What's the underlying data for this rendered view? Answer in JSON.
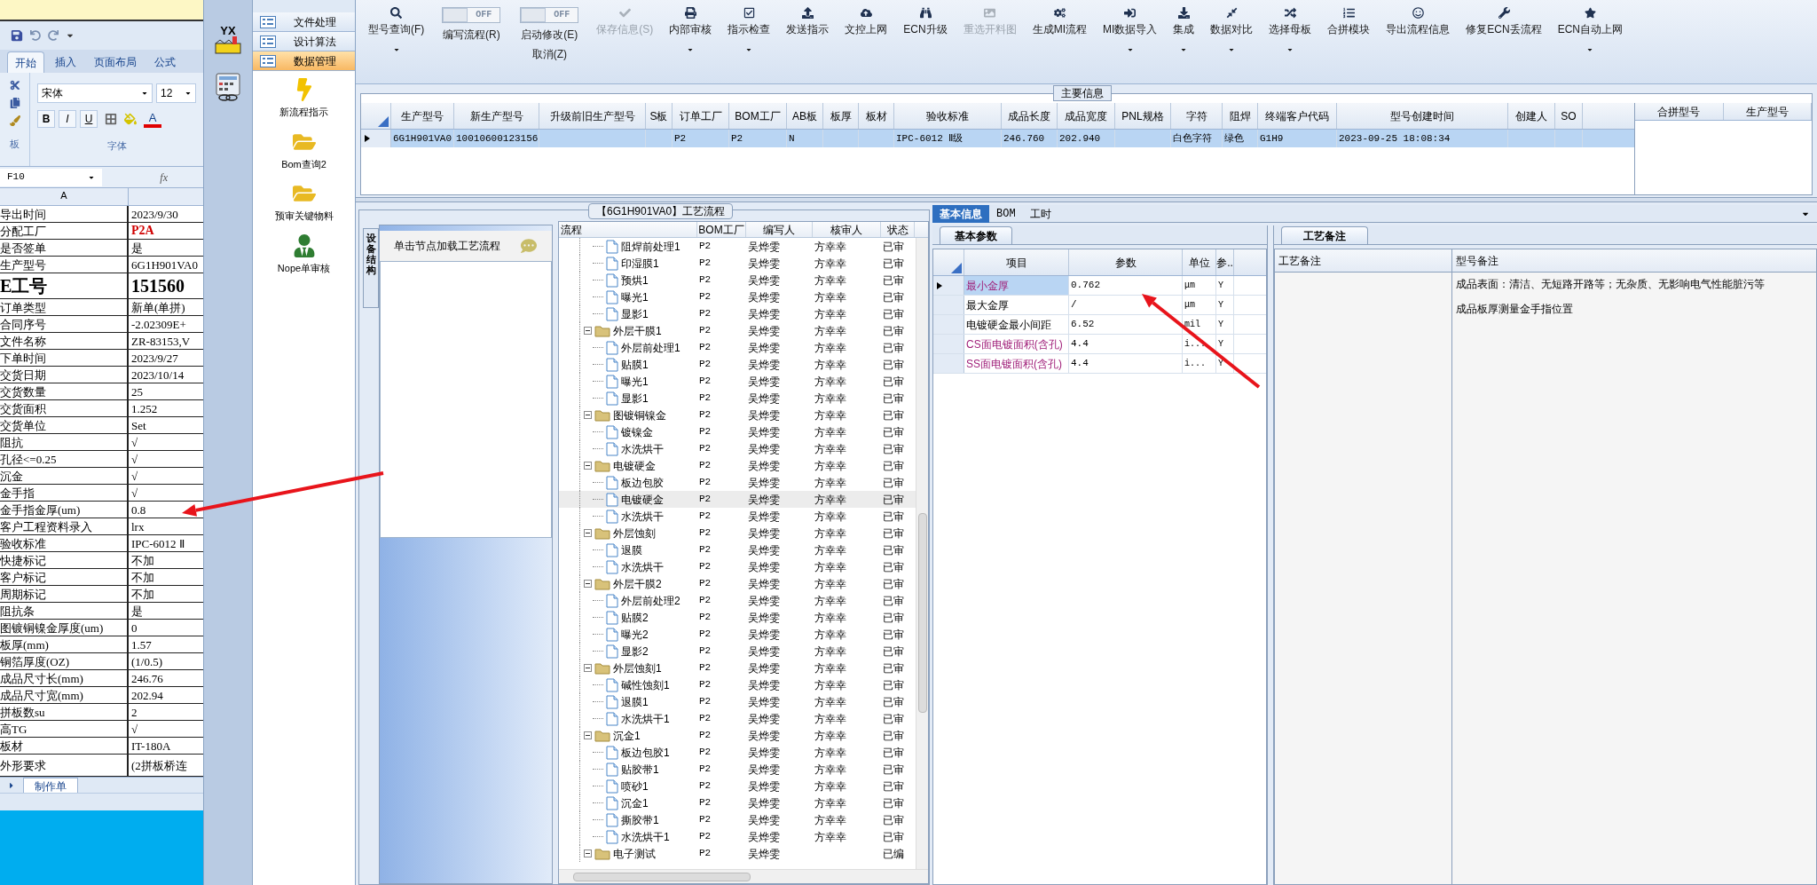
{
  "excel": {
    "tabs": [
      {
        "label": "开始",
        "selected": true
      },
      {
        "label": "插入",
        "selected": false
      },
      {
        "label": "页面布局",
        "selected": false
      },
      {
        "label": "公式",
        "selected": false
      }
    ],
    "font": "宋体",
    "size": "12",
    "format_buttons": [
      "B",
      "I",
      "U"
    ],
    "font_color_button": "A",
    "clipboard_label": "板",
    "font_group_label": "字体",
    "name_box": "F10",
    "fx": "fx",
    "column_header": "A",
    "sheet_tab": "制作单",
    "rows": [
      {
        "label": "导出时间",
        "value": "2023/9/30",
        "kind": "normal"
      },
      {
        "label": "分配工厂",
        "value": "P2A",
        "kind": "alert"
      },
      {
        "label": "是否签单",
        "value": "是",
        "kind": "normal"
      },
      {
        "label": "生产型号",
        "value": "6G1H901VA0",
        "kind": "normal"
      },
      {
        "label": "E工号",
        "value": "151560",
        "kind": "large"
      },
      {
        "label": "订单类型",
        "value": "新单(单拼)",
        "kind": "normal"
      },
      {
        "label": "合同序号",
        "value": "-2.02309E+",
        "kind": "normal"
      },
      {
        "label": "文件名称",
        "value": "ZR-83153,V",
        "kind": "normal"
      },
      {
        "label": "下单时间",
        "value": "2023/9/27",
        "kind": "normal"
      },
      {
        "label": "交货日期",
        "value": "2023/10/14",
        "kind": "normal"
      },
      {
        "label": "交货数量",
        "value": "25",
        "kind": "normal"
      },
      {
        "label": "交货面积",
        "value": "1.252",
        "kind": "normal"
      },
      {
        "label": "交货单位",
        "value": "Set",
        "kind": "normal"
      },
      {
        "label": "阻抗",
        "value": "√",
        "kind": "normal"
      },
      {
        "label": "孔径<=0.25",
        "value": "√",
        "kind": "normal"
      },
      {
        "label": "沉金",
        "value": "√",
        "kind": "normal"
      },
      {
        "label": "金手指",
        "value": "√",
        "kind": "normal"
      },
      {
        "label": "金手指金厚(um)",
        "value": "0.8",
        "kind": "normal"
      },
      {
        "label": "客户工程资料录入",
        "value": "lrx",
        "kind": "normal"
      },
      {
        "label": "验收标准",
        "value": "IPC-6012 Ⅱ",
        "kind": "normal"
      },
      {
        "label": "快捷标记",
        "value": "不加",
        "kind": "normal"
      },
      {
        "label": "客户标记",
        "value": "不加",
        "kind": "normal"
      },
      {
        "label": "周期标记",
        "value": "不加",
        "kind": "normal"
      },
      {
        "label": "阻抗条",
        "value": "是",
        "kind": "normal"
      },
      {
        "label": "图镀铜镍金厚度(um)",
        "value": "0",
        "kind": "normal"
      },
      {
        "label": "板厚(mm)",
        "value": "1.57",
        "kind": "normal"
      },
      {
        "label": "铜箔厚度(OZ)",
        "value": "(1/0.5)",
        "kind": "normal"
      },
      {
        "label": "成品尺寸长(mm)",
        "value": "246.76",
        "kind": "normal"
      },
      {
        "label": "成品尺寸宽(mm)",
        "value": "202.94",
        "kind": "normal"
      },
      {
        "label": "拼板数su",
        "value": "2",
        "kind": "normal"
      },
      {
        "label": "高TG",
        "value": "√",
        "kind": "normal"
      },
      {
        "label": "板材",
        "value": "IT-180A",
        "kind": "normal"
      },
      {
        "label": "外形要求",
        "value": "(2拼板桥连",
        "kind": "tall"
      }
    ]
  },
  "app": {
    "logo_text": "YX",
    "nav": [
      {
        "label": "文件处理",
        "selected": false
      },
      {
        "label": "设计算法",
        "selected": false
      },
      {
        "label": "数据管理",
        "selected": true
      }
    ],
    "shortcuts": [
      "新流程指示",
      "Bom查询2",
      "预审关键物料",
      "Nope单审核"
    ]
  },
  "toolbar": [
    {
      "kind": "button",
      "label": "型号查询(F)",
      "dropdown": true,
      "disabled": false
    },
    {
      "kind": "toggle",
      "switch_text": "OFF",
      "on": false,
      "label": "编写流程(R)"
    },
    {
      "kind": "toggle",
      "switch_text": "OFF",
      "on": false,
      "label": "启动修改(E)",
      "sublabel": "取消(Z)"
    },
    {
      "kind": "button",
      "label": "保存信息(S)",
      "dropdown": false,
      "disabled": true
    },
    {
      "kind": "button",
      "label": "内部审核",
      "dropdown": true,
      "disabled": false
    },
    {
      "kind": "button",
      "label": "指示检查",
      "dropdown": true,
      "disabled": false
    },
    {
      "kind": "button",
      "label": "发送指示",
      "dropdown": false,
      "disabled": false
    },
    {
      "kind": "button",
      "label": "文控上网",
      "dropdown": false,
      "disabled": false
    },
    {
      "kind": "button",
      "label": "ECN升级",
      "dropdown": false,
      "disabled": false
    },
    {
      "kind": "button",
      "label": "重选开料图",
      "dropdown": false,
      "disabled": true
    },
    {
      "kind": "button",
      "label": "生成MI流程",
      "dropdown": false,
      "disabled": false
    },
    {
      "kind": "button",
      "label": "MI数据导入",
      "dropdown": true,
      "disabled": false
    },
    {
      "kind": "button",
      "label": "集成",
      "dropdown": true,
      "disabled": false
    },
    {
      "kind": "button",
      "label": "数据对比",
      "dropdown": true,
      "disabled": false
    },
    {
      "kind": "button",
      "label": "选择母板",
      "dropdown": true,
      "disabled": false
    },
    {
      "kind": "button",
      "label": "合拼模块",
      "dropdown": false,
      "disabled": false
    },
    {
      "kind": "button",
      "label": "导出流程信息",
      "dropdown": false,
      "disabled": false
    },
    {
      "kind": "button",
      "label": "修复ECN丢流程",
      "dropdown": false,
      "disabled": false
    },
    {
      "kind": "button",
      "label": "ECN自动上网",
      "dropdown": true,
      "disabled": false
    }
  ],
  "main_info": {
    "title": "主要信息",
    "columns": [
      "生产型号",
      "新生产型号",
      "升级前旧生产型号",
      "S板",
      "订单工厂",
      "BOM工厂",
      "AB板",
      "板厚",
      "板材",
      "验收标准",
      "成品长度",
      "成品宽度",
      "PNL规格",
      "字符",
      "阻焊",
      "终端客户代码",
      "型号创建时间",
      "创建人",
      "SO"
    ],
    "rows": [
      {
        "selected": true,
        "cells": [
          "6G1H901VA0",
          "10010600123156",
          null,
          null,
          "P2",
          "P2",
          "N",
          null,
          null,
          "IPC-6012 Ⅱ级",
          "246.760",
          "202.940",
          null,
          "白色字符",
          "绿色",
          "G1H9",
          "2023-09-25 18:08:34",
          null,
          null
        ]
      }
    ],
    "merge_columns": [
      "合拼型号",
      "生产型号"
    ]
  },
  "process": {
    "title": "【6G1H901VA0】工艺流程",
    "side_tab": "设备结构",
    "hint": "单击节点加载工艺流程",
    "columns": [
      "流程",
      "BOM工厂",
      "编写人",
      "核审人",
      "状态"
    ],
    "nodes": [
      {
        "kind": "continued",
        "children": [
          {
            "label": "阻焊前处理1",
            "bom": "P2",
            "writer": "吴烨雯",
            "reviewer": "方幸幸",
            "status": "已审",
            "selected": false
          },
          {
            "label": "印湿膜1",
            "bom": "P2",
            "writer": "吴烨雯",
            "reviewer": "方幸幸",
            "status": "已审",
            "selected": false
          },
          {
            "label": "预烘1",
            "bom": "P2",
            "writer": "吴烨雯",
            "reviewer": "方幸幸",
            "status": "已审",
            "selected": false
          },
          {
            "label": "曝光1",
            "bom": "P2",
            "writer": "吴烨雯",
            "reviewer": "方幸幸",
            "status": "已审",
            "selected": false
          },
          {
            "label": "显影1",
            "bom": "P2",
            "writer": "吴烨雯",
            "reviewer": "方幸幸",
            "status": "已审",
            "selected": false
          }
        ]
      },
      {
        "kind": "group",
        "label": "外层干膜1",
        "bom": "P2",
        "writer": "吴烨雯",
        "reviewer": "方幸幸",
        "status": "已审",
        "selected": false,
        "expanded": true,
        "children": [
          {
            "label": "外层前处理1",
            "bom": "P2",
            "writer": "吴烨雯",
            "reviewer": "方幸幸",
            "status": "已审",
            "selected": false
          },
          {
            "label": "贴膜1",
            "bom": "P2",
            "writer": "吴烨雯",
            "reviewer": "方幸幸",
            "status": "已审",
            "selected": false
          },
          {
            "label": "曝光1",
            "bom": "P2",
            "writer": "吴烨雯",
            "reviewer": "方幸幸",
            "status": "已审",
            "selected": false
          },
          {
            "label": "显影1",
            "bom": "P2",
            "writer": "吴烨雯",
            "reviewer": "方幸幸",
            "status": "已审",
            "selected": false
          }
        ]
      },
      {
        "kind": "group",
        "label": "图镀铜镍金",
        "bom": "P2",
        "writer": "吴烨雯",
        "reviewer": "方幸幸",
        "status": "已审",
        "selected": false,
        "expanded": true,
        "children": [
          {
            "label": "镀镍金",
            "bom": "P2",
            "writer": "吴烨雯",
            "reviewer": "方幸幸",
            "status": "已审",
            "selected": false
          },
          {
            "label": "水洗烘干",
            "bom": "P2",
            "writer": "吴烨雯",
            "reviewer": "方幸幸",
            "status": "已审",
            "selected": false
          }
        ]
      },
      {
        "kind": "group",
        "label": "电镀硬金",
        "bom": "P2",
        "writer": "吴烨雯",
        "reviewer": "方幸幸",
        "status": "已审",
        "selected": false,
        "expanded": true,
        "children": [
          {
            "label": "板边包胶",
            "bom": "P2",
            "writer": "吴烨雯",
            "reviewer": "方幸幸",
            "status": "已审",
            "selected": false
          },
          {
            "label": "电镀硬金",
            "bom": "P2",
            "writer": "吴烨雯",
            "reviewer": "方幸幸",
            "status": "已审",
            "selected": true
          },
          {
            "label": "水洗烘干",
            "bom": "P2",
            "writer": "吴烨雯",
            "reviewer": "方幸幸",
            "status": "已审",
            "selected": false
          }
        ]
      },
      {
        "kind": "group",
        "label": "外层蚀刻",
        "bom": "P2",
        "writer": "吴烨雯",
        "reviewer": "方幸幸",
        "status": "已审",
        "selected": false,
        "expanded": true,
        "children": [
          {
            "label": "退膜",
            "bom": "P2",
            "writer": "吴烨雯",
            "reviewer": "方幸幸",
            "status": "已审",
            "selected": false
          },
          {
            "label": "水洗烘干",
            "bom": "P2",
            "writer": "吴烨雯",
            "reviewer": "方幸幸",
            "status": "已审",
            "selected": false
          }
        ]
      },
      {
        "kind": "group",
        "label": "外层干膜2",
        "bom": "P2",
        "writer": "吴烨雯",
        "reviewer": "方幸幸",
        "status": "已审",
        "selected": false,
        "expanded": true,
        "children": [
          {
            "label": "外层前处理2",
            "bom": "P2",
            "writer": "吴烨雯",
            "reviewer": "方幸幸",
            "status": "已审",
            "selected": false
          },
          {
            "label": "贴膜2",
            "bom": "P2",
            "writer": "吴烨雯",
            "reviewer": "方幸幸",
            "status": "已审",
            "selected": false
          },
          {
            "label": "曝光2",
            "bom": "P2",
            "writer": "吴烨雯",
            "reviewer": "方幸幸",
            "status": "已审",
            "selected": false
          },
          {
            "label": "显影2",
            "bom": "P2",
            "writer": "吴烨雯",
            "reviewer": "方幸幸",
            "status": "已审",
            "selected": false
          }
        ]
      },
      {
        "kind": "group",
        "label": "外层蚀刻1",
        "bom": "P2",
        "writer": "吴烨雯",
        "reviewer": "方幸幸",
        "status": "已审",
        "selected": false,
        "expanded": true,
        "children": [
          {
            "label": "碱性蚀刻1",
            "bom": "P2",
            "writer": "吴烨雯",
            "reviewer": "方幸幸",
            "status": "已审",
            "selected": false
          },
          {
            "label": "退膜1",
            "bom": "P2",
            "writer": "吴烨雯",
            "reviewer": "方幸幸",
            "status": "已审",
            "selected": false
          },
          {
            "label": "水洗烘干1",
            "bom": "P2",
            "writer": "吴烨雯",
            "reviewer": "方幸幸",
            "status": "已审",
            "selected": false
          }
        ]
      },
      {
        "kind": "group",
        "label": "沉金1",
        "bom": "P2",
        "writer": "吴烨雯",
        "reviewer": "方幸幸",
        "status": "已审",
        "selected": false,
        "expanded": true,
        "children": [
          {
            "label": "板边包胶1",
            "bom": "P2",
            "writer": "吴烨雯",
            "reviewer": "方幸幸",
            "status": "已审",
            "selected": false
          },
          {
            "label": "贴胶带1",
            "bom": "P2",
            "writer": "吴烨雯",
            "reviewer": "方幸幸",
            "status": "已审",
            "selected": false
          },
          {
            "label": "喷砂1",
            "bom": "P2",
            "writer": "吴烨雯",
            "reviewer": "方幸幸",
            "status": "已审",
            "selected": false
          },
          {
            "label": "沉金1",
            "bom": "P2",
            "writer": "吴烨雯",
            "reviewer": "方幸幸",
            "status": "已审",
            "selected": false
          },
          {
            "label": "撕胶带1",
            "bom": "P2",
            "writer": "吴烨雯",
            "reviewer": "方幸幸",
            "status": "已审",
            "selected": false
          },
          {
            "label": "水洗烘干1",
            "bom": "P2",
            "writer": "吴烨雯",
            "reviewer": "方幸幸",
            "status": "已审",
            "selected": false
          }
        ]
      },
      {
        "kind": "group",
        "label": "电子测试",
        "bom": "P2",
        "writer": "吴烨雯",
        "status": "已编",
        "selected": false,
        "expanded": true
      }
    ]
  },
  "details": {
    "tabs": [
      {
        "label": "基本信息",
        "selected": true
      },
      {
        "label": "BOM",
        "selected": false
      },
      {
        "label": "工时",
        "selected": false
      }
    ],
    "params": {
      "tab": "基本参数",
      "columns": [
        "项目",
        "参数",
        "单位",
        "参.."
      ],
      "rows": [
        {
          "name": "最小金厚",
          "value": "0.762",
          "unit": "μm",
          "flag": "Y",
          "kind": "highlight",
          "selected": true
        },
        {
          "name": "最大金厚",
          "value": "/",
          "unit": "μm",
          "flag": "Y",
          "kind": "normal",
          "selected": false
        },
        {
          "name": "电镀硬金最小间距",
          "value": "6.52",
          "unit": "mil",
          "flag": "Y",
          "kind": "normal",
          "selected": false
        },
        {
          "name": "CS面电镀面积(含孔)",
          "value": "4.4",
          "unit": "i...",
          "flag": "Y",
          "kind": "highlight",
          "selected": false
        },
        {
          "name": "SS面电镀面积(含孔)",
          "value": "4.4",
          "unit": "i...",
          "flag": "Y",
          "kind": "highlight",
          "selected": false
        }
      ]
    },
    "notes": {
      "tab": "工艺备注",
      "columns": [
        "工艺备注",
        "型号备注"
      ],
      "model_notes": [
        "成品表面：清洁、无短路开路等；无杂质、无影响电气性能脏污等",
        "成品板厚测量金手指位置"
      ]
    }
  }
}
